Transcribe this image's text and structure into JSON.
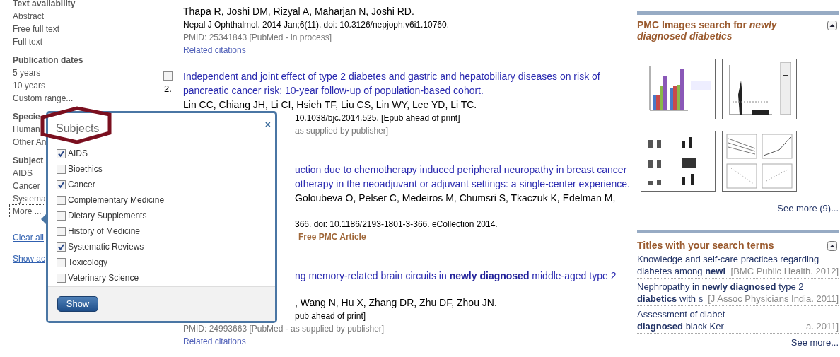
{
  "sidebar": {
    "groups": [
      {
        "heading": "Text availability",
        "items": [
          {
            "label": "Abstract",
            "focused": false
          },
          {
            "label": "Free full text",
            "focused": false
          },
          {
            "label": "Full text",
            "focused": false
          }
        ]
      },
      {
        "heading": "Publication dates",
        "items": [
          {
            "label": "5 years",
            "focused": false
          },
          {
            "label": "10 years",
            "focused": false
          },
          {
            "label": "Custom range...",
            "focused": false
          }
        ]
      },
      {
        "heading": "Specie",
        "items": [
          {
            "label": "Human",
            "focused": false
          },
          {
            "label": "Other An",
            "focused": false
          }
        ]
      },
      {
        "heading": "Subject",
        "items": [
          {
            "label": "AIDS",
            "focused": false
          },
          {
            "label": "Cancer",
            "focused": false
          },
          {
            "label": "Systema",
            "focused": false
          },
          {
            "label": "More ...",
            "focused": true
          }
        ]
      }
    ],
    "links": [
      "Clear all",
      "Show ac"
    ]
  },
  "results": [
    {
      "lines": [
        {
          "kind": "authors",
          "text": "Thapa R, Joshi DM, Rizyal A, Maharjan N, Joshi RD."
        },
        {
          "kind": "journal",
          "text": "Nepal J Ophthalmol. 2014 Jan;6(11). doi: 10.3126/nepjoph.v6i1.10760."
        },
        {
          "kind": "pmid",
          "text": "PMID: 25341843 [PubMed - in process]"
        },
        {
          "kind": "related",
          "text": "Related citations"
        }
      ]
    },
    {
      "number": "2.",
      "checked": false,
      "lines": [
        {
          "kind": "title",
          "text": "Independent and joint effect of type 2 diabetes and gastric and hepatobiliary diseases on risk of pancreatic cancer risk: 10-year follow-up of population-based cohort."
        },
        {
          "kind": "authors",
          "text": "Lin CC, Chiang JH, Li CI, Hsieh TF, Liu CS, Lin WY, Lee YD, Li TC."
        },
        {
          "kind": "journal",
          "text": "10.1038/bjc.2014.525. [Epub ahead of print]"
        },
        {
          "kind": "pmid",
          "text": "as supplied by publisher]"
        }
      ]
    },
    {
      "lines": [
        {
          "kind": "title",
          "text": "uction due to chemotherapy induced peripheral neuropathy in breast cancer"
        },
        {
          "kind": "title",
          "text": "otherapy in the neoadjuvant or adjuvant settings: a single-center experience."
        },
        {
          "kind": "authors",
          "text": "Goloubeva O, Pelser C, Medeiros M, Chumsri S, Tkaczuk K, Edelman M,"
        },
        {
          "kind": "journal",
          "text": "366. doi: 10.1186/2193-1801-3-366. eCollection 2014."
        },
        {
          "kind": "free",
          "text": "Free PMC Article"
        }
      ]
    },
    {
      "lines": [
        {
          "kind": "title",
          "text": "ng memory-related brain circuits in **newly diagnosed** middle-aged type 2"
        },
        {
          "kind": "authors",
          "text": ", Wang N, Hu X, Zhang DR, Zhu DF, Zhou JN."
        },
        {
          "kind": "journal",
          "text": "pub ahead of print]"
        },
        {
          "kind": "pmid",
          "text": "PMID: 24993663 [PubMed - as supplied by publisher]"
        },
        {
          "kind": "related",
          "text": "Related citations"
        }
      ]
    }
  ],
  "popup": {
    "title": "Subjects",
    "close": "×",
    "items": [
      {
        "label": "AIDS",
        "checked": true
      },
      {
        "label": "Bioethics",
        "checked": false
      },
      {
        "label": "Cancer",
        "checked": true
      },
      {
        "label": "Complementary Medicine",
        "checked": false
      },
      {
        "label": "Dietary Supplements",
        "checked": false
      },
      {
        "label": "History of Medicine",
        "checked": false
      },
      {
        "label": "Systematic Reviews",
        "checked": true
      },
      {
        "label": "Toxicology",
        "checked": false
      },
      {
        "label": "Veterinary Science",
        "checked": false
      }
    ],
    "button": "Show"
  },
  "images_panel": {
    "heading": "PMC Images search for *newly diagnosed diabetics*",
    "see_more": "See more (9)..."
  },
  "titles_panel": {
    "heading": "Titles with your search terms",
    "items": [
      {
        "lines": [
          "Knowledge and self-care practices regarding",
          "diabetes among **newl**"
        ],
        "source": "[BMC Public Health. 2012]"
      },
      {
        "lines": [
          "Nephropathy in **newly diagnosed** type 2",
          "**diabetics** with s"
        ],
        "source": "[J Assoc Physicians India. 2011]"
      },
      {
        "lines": [
          "Assessment of diabet",
          "**diagnosed** black Ker"
        ],
        "source": "a. 2011]"
      }
    ],
    "see_more": "See more..."
  }
}
